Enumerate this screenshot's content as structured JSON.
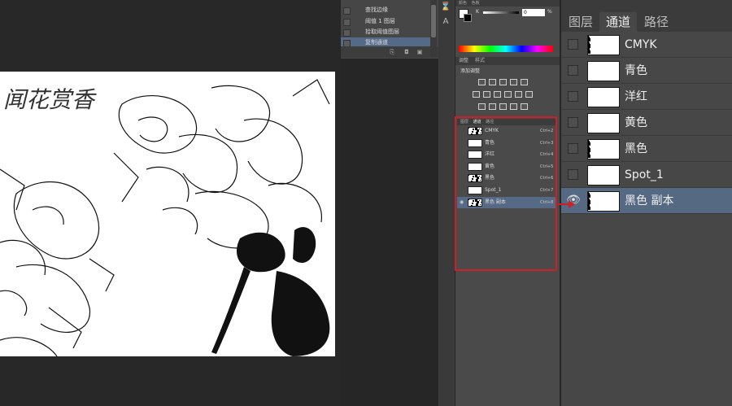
{
  "history": {
    "items": [
      {
        "label": "查找边缘"
      },
      {
        "label": "阈值 1 图层"
      },
      {
        "label": "拾取阈值图层"
      },
      {
        "label": "复制通道",
        "active": true
      }
    ]
  },
  "color_panel": {
    "tabs": [
      "颜色",
      "色板"
    ],
    "channel_label": "K",
    "value": "0",
    "unit": "%"
  },
  "adjustments": {
    "tabs": [
      "调整",
      "样式"
    ],
    "title": "添加调整"
  },
  "small_channels": {
    "tabs": [
      "图层",
      "通道",
      "路径"
    ],
    "rows": [
      {
        "name": "CMYK",
        "shortcut": "Ctrl+2",
        "thumb": "art"
      },
      {
        "name": "青色",
        "shortcut": "Ctrl+3",
        "thumb": "white"
      },
      {
        "name": "洋红",
        "shortcut": "Ctrl+4",
        "thumb": "white"
      },
      {
        "name": "黄色",
        "shortcut": "Ctrl+5",
        "thumb": "white"
      },
      {
        "name": "黑色",
        "shortcut": "Ctrl+6",
        "thumb": "art"
      },
      {
        "name": "Spot_1",
        "shortcut": "Ctrl+7",
        "thumb": "white"
      },
      {
        "name": "黑色 副本",
        "shortcut": "Ctrl+8",
        "thumb": "art",
        "active": true
      }
    ]
  },
  "right_channels": {
    "tabs": [
      "图层",
      "通道",
      "路径"
    ],
    "active_tab": "通道",
    "rows": [
      {
        "name": "CMYK",
        "thumb": "art"
      },
      {
        "name": "青色",
        "thumb": "white"
      },
      {
        "name": "洋红",
        "thumb": "white"
      },
      {
        "name": "黄色",
        "thumb": "white"
      },
      {
        "name": "黑色",
        "thumb": "art"
      },
      {
        "name": "Spot_1",
        "thumb": "white"
      },
      {
        "name": "黑色 副本",
        "thumb": "art",
        "active": true
      }
    ]
  },
  "document": {
    "calligraphy": "闻花赏香"
  },
  "colors": {
    "accent_highlight": "#cc1f26",
    "active_row": "#556983"
  }
}
